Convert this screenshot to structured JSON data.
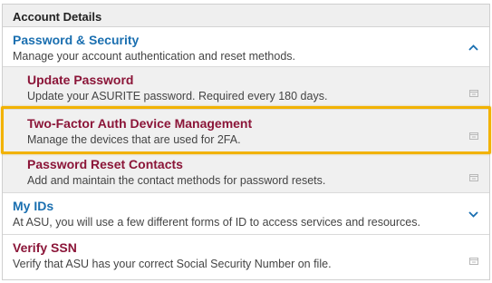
{
  "panel": {
    "header": "Account Details"
  },
  "sections": [
    {
      "title": "Password & Security",
      "description": "Manage your account authentication and reset methods.",
      "expanded": true,
      "children": [
        {
          "title": "Update Password",
          "description": "Update your ASURITE password. Required every 180 days."
        },
        {
          "title": "Two-Factor Auth Device Management",
          "description": "Manage the devices that are used for 2FA."
        },
        {
          "title": "Password Reset Contacts",
          "description": "Add and maintain the contact methods for password resets."
        }
      ]
    },
    {
      "title": "My IDs",
      "description": "At ASU, you will use a few different forms of ID to access services and resources.",
      "expanded": false
    },
    {
      "title": "Verify SSN",
      "description": "Verify that ASU has your correct Social Security Number on file."
    }
  ],
  "colors": {
    "section_title": "#1a6fb0",
    "child_title": "#8b1538",
    "highlight": "#f2b200"
  },
  "icons": {
    "expanded": "chevron-up-icon",
    "collapsed": "chevron-down-icon",
    "link": "external-link-icon"
  }
}
